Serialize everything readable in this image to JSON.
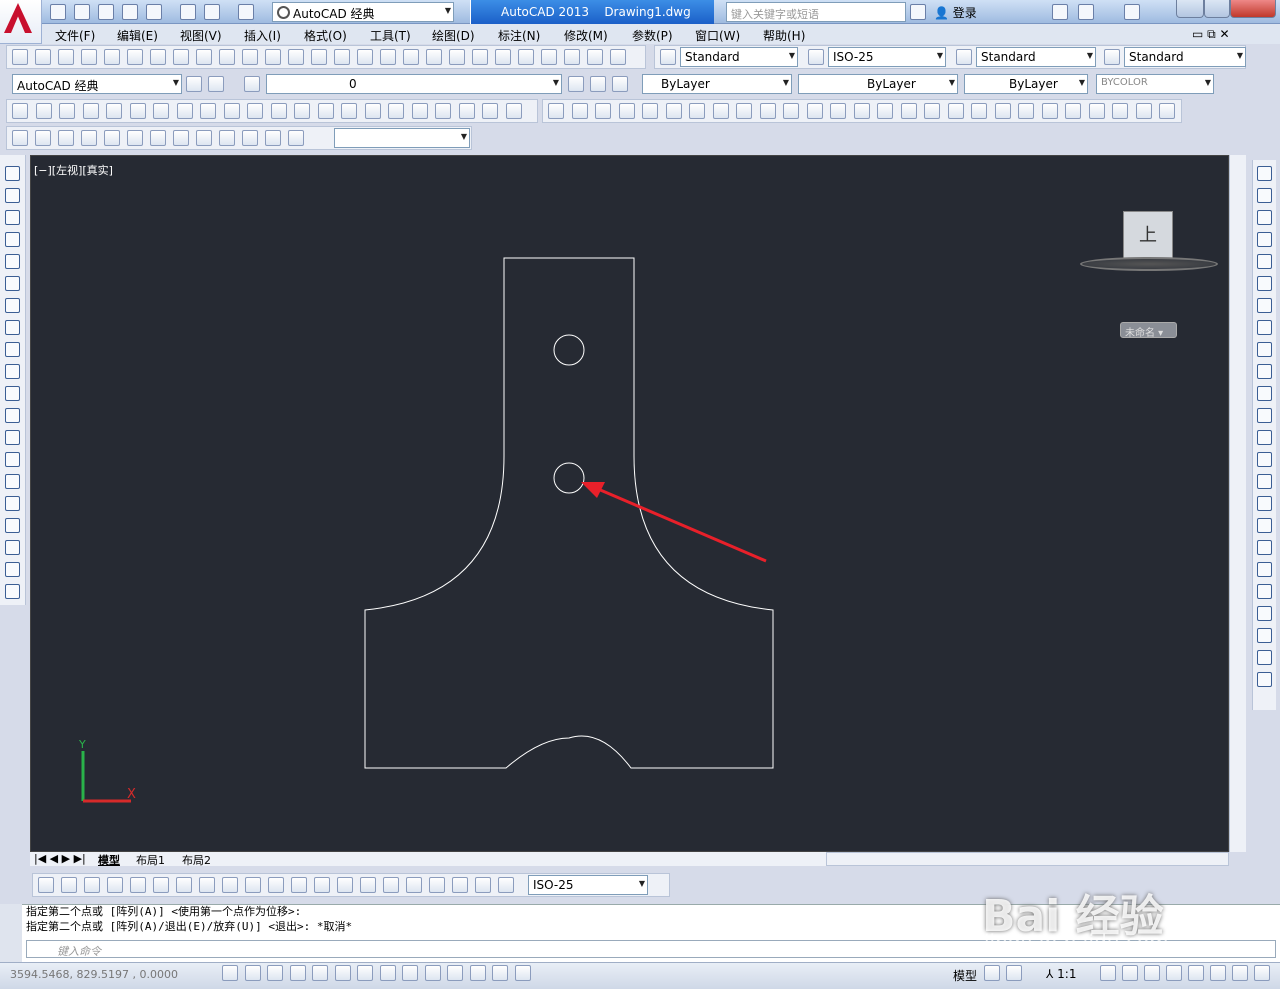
{
  "title": {
    "app": "AutoCAD 2013",
    "file": "Drawing1.dwg",
    "workspace": "AutoCAD 经典",
    "search_placeholder": "键入关键字或短语",
    "login": "登录"
  },
  "menu": [
    "文件(F)",
    "编辑(E)",
    "视图(V)",
    "插入(I)",
    "格式(O)",
    "工具(T)",
    "绘图(D)",
    "标注(N)",
    "修改(M)",
    "参数(P)",
    "窗口(W)",
    "帮助(H)"
  ],
  "styles_toolbar": {
    "text_style": "Standard",
    "dim_style": "ISO-25",
    "table_style": "Standard",
    "mleader_style": "Standard"
  },
  "layers_toolbar": {
    "workspace": "AutoCAD 经典",
    "layer": "0",
    "color": "ByLayer",
    "linetype": "ByLayer",
    "lineweight": "ByLayer",
    "plotstyle": "BYCOLOR"
  },
  "viewport": {
    "label": "[−][左视][真实]",
    "viewcube_face": "上",
    "unnamed_ucs": "未命名 ▾"
  },
  "layout_tabs": [
    "模型",
    "布局1",
    "布局2"
  ],
  "dim_toolbar": {
    "dim_style": "ISO-25"
  },
  "command": {
    "history": [
      "指定第二个点或 [阵列(A)] <使用第一个点作为位移>:",
      "指定第二个点或 [阵列(A)/退出(E)/放弃(U)] <退出>: *取消*"
    ],
    "input_placeholder": "键入命令"
  },
  "status": {
    "coords": "3594.5468, 829.5197 , 0.0000",
    "model": "模型",
    "scale": "1:1"
  },
  "watermark": {
    "main": "Bai 经验",
    "sub": "jingyan.baidu.com"
  },
  "colors": {
    "canvas": "#262a33",
    "arrow": "#e8202a",
    "lines": "#ffffff"
  }
}
